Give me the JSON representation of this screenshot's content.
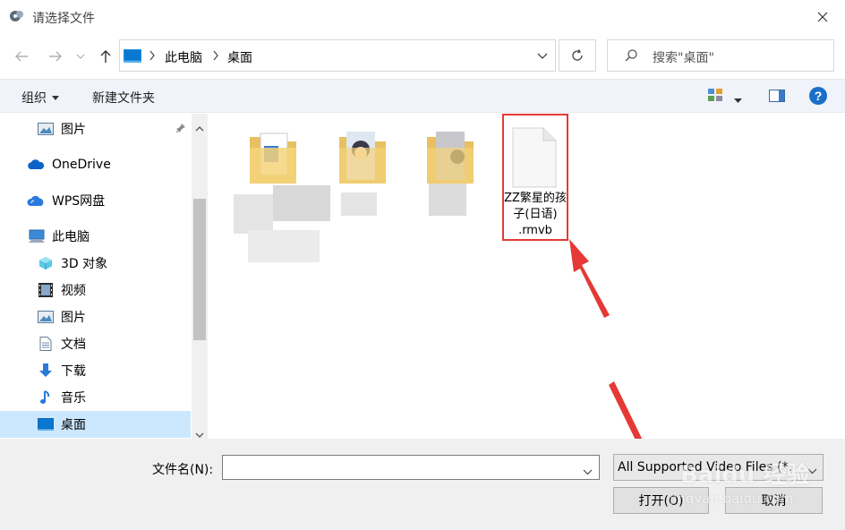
{
  "window": {
    "title": "请选择文件",
    "close_icon": "close-icon"
  },
  "nav": {
    "breadcrumb": [
      "此电脑",
      "桌面"
    ],
    "search_placeholder": "搜索\"桌面\""
  },
  "toolbar": {
    "organize_label": "组织",
    "new_folder_label": "新建文件夹"
  },
  "sidebar": {
    "items": [
      {
        "label": "图片",
        "icon": "pictures-icon",
        "pinned": true
      },
      {
        "label": "OneDrive",
        "icon": "onedrive-icon"
      },
      {
        "label": "WPS网盘",
        "icon": "wps-cloud-icon"
      },
      {
        "label": "此电脑",
        "icon": "computer-icon"
      },
      {
        "label": "3D 对象",
        "icon": "3d-objects-icon"
      },
      {
        "label": "视频",
        "icon": "videos-icon"
      },
      {
        "label": "图片",
        "icon": "pictures-icon"
      },
      {
        "label": "文档",
        "icon": "documents-icon"
      },
      {
        "label": "下载",
        "icon": "downloads-icon"
      },
      {
        "label": "音乐",
        "icon": "music-icon"
      },
      {
        "label": "桌面",
        "icon": "desktop-icon",
        "selected": true
      }
    ]
  },
  "files": [
    {
      "name": "",
      "icon": "folder-icon",
      "blurred": true
    },
    {
      "name": "",
      "icon": "folder-icon",
      "blurred": true
    },
    {
      "name": "",
      "icon": "folder-icon",
      "blurred": true
    },
    {
      "name": "ZZ繁星的孩子(日语).rmvb",
      "name_lines": [
        "ZZ繁星的孩",
        "子(日语)",
        ".rmvb"
      ],
      "icon": "file-icon",
      "highlighted": true
    }
  ],
  "footer": {
    "filename_label": "文件名(N):",
    "filename_value": "",
    "filetype_value": "All Supported Video Files (*.",
    "open_label": "打开(O)",
    "cancel_label": "取消"
  },
  "annotation": {
    "highlight_color": "#e53935",
    "arrow_color": "#e53935"
  },
  "watermark": {
    "text": "Baidu 经验",
    "subtext": "jingyan.baidu.com"
  }
}
